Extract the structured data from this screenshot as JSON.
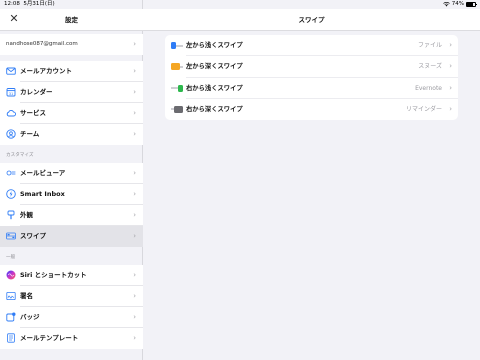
{
  "status_bar": {
    "time": "12:08",
    "date": "5月31日(日)",
    "battery": "74%",
    "battery_level": 0.74
  },
  "sidebar": {
    "title": "設定",
    "account_email": "nandhose087@gmail.com",
    "groups": [
      {
        "label": "",
        "items": [
          {
            "label": "メールアカウント",
            "icon": "mail-icon"
          },
          {
            "label": "カレンダー",
            "icon": "calendar-icon"
          },
          {
            "label": "サービス",
            "icon": "cloud-icon"
          },
          {
            "label": "チーム",
            "icon": "team-icon"
          }
        ]
      },
      {
        "label": "カスタマイズ",
        "items": [
          {
            "label": "メールビューア",
            "icon": "mail-viewer-icon"
          },
          {
            "label": "Smart Inbox",
            "icon": "smart-inbox-icon"
          },
          {
            "label": "外観",
            "icon": "appearance-icon"
          },
          {
            "label": "スワイプ",
            "icon": "swipe-icon",
            "selected": true
          }
        ]
      },
      {
        "label": "一般",
        "items": [
          {
            "label": "Siri とショートカット",
            "icon": "siri-icon"
          },
          {
            "label": "署名",
            "icon": "signature-icon"
          },
          {
            "label": "バッジ",
            "icon": "badge-icon"
          },
          {
            "label": "メールテンプレート",
            "icon": "template-icon"
          }
        ]
      }
    ]
  },
  "detail": {
    "title": "スワイプ",
    "swipe_options": [
      {
        "label": "左から浅くスワイプ",
        "value": "ファイル",
        "icon": "swipe-left-short-icon",
        "color": "#2f7cf6"
      },
      {
        "label": "左から深くスワイプ",
        "value": "スヌーズ",
        "icon": "swipe-left-long-icon",
        "color": "#f5a623"
      },
      {
        "label": "右から浅くスワイプ",
        "value": "Evernote",
        "icon": "swipe-right-short-icon",
        "color": "#2db84d"
      },
      {
        "label": "右から深くスワイプ",
        "value": "リマインダー",
        "icon": "swipe-right-long-icon",
        "color": "#6b6b70"
      }
    ]
  },
  "colors": {
    "accent": "#2f7cf6",
    "chevron": "#a0a0a6",
    "selected_row": "#e3e3e8"
  }
}
